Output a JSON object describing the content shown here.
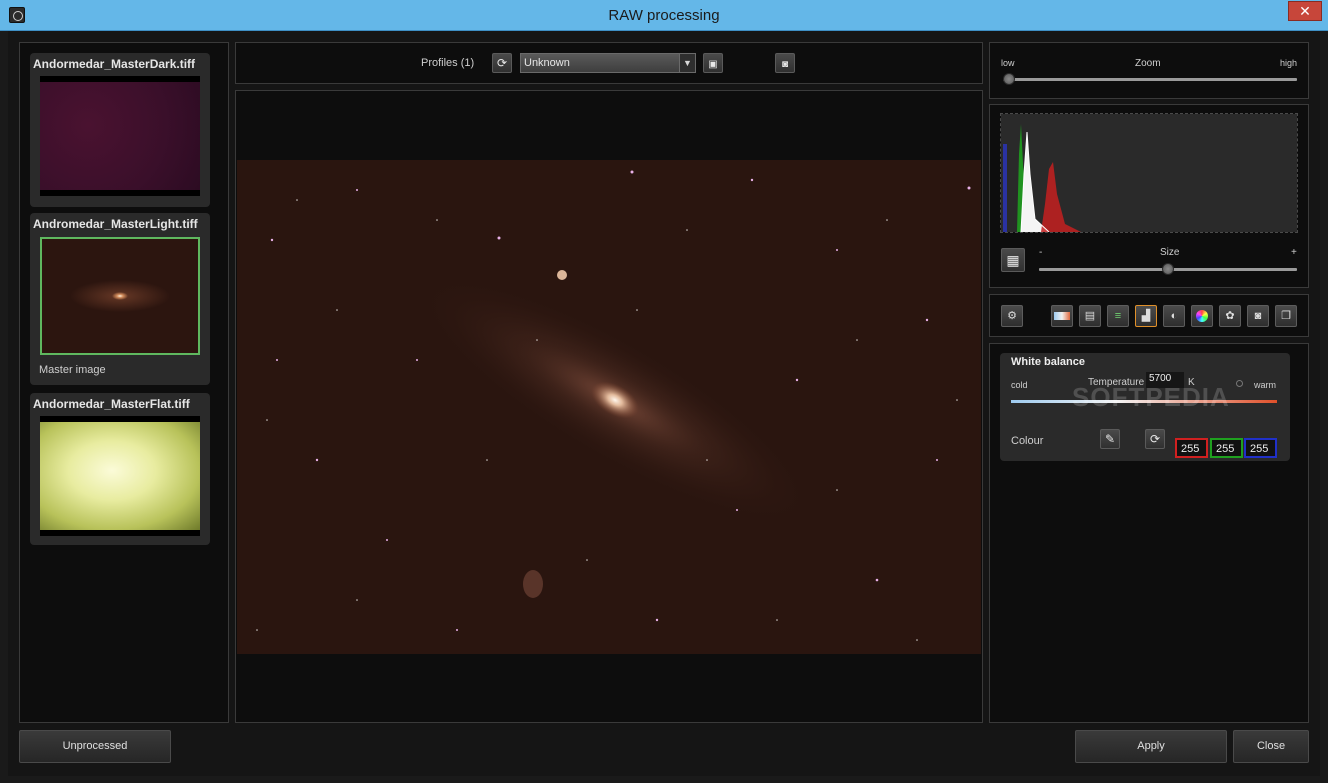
{
  "window": {
    "title": "RAW processing",
    "close_glyph": "✕"
  },
  "frames": [
    {
      "name": "Andormedar_MasterDark.tiff",
      "caption": ""
    },
    {
      "name": "Andromedar_MasterLight.tiff",
      "caption": "Master image"
    },
    {
      "name": "Andormedar_MasterFlat.tiff",
      "caption": ""
    }
  ],
  "toolbar": {
    "profiles_label": "Profiles (1)",
    "profile_value": "Unknown"
  },
  "zoom": {
    "low_label": "low",
    "title": "Zoom",
    "high_label": "high",
    "level": 0.0
  },
  "histogram": {
    "size_minus": "-",
    "size_title": "Size",
    "size_plus": "+",
    "size_level": 0.5
  },
  "white_balance": {
    "title": "White balance",
    "cold_label": "cold",
    "temperature_label": "Temperature",
    "temperature_value": "5700",
    "temperature_unit": "K",
    "warm_label": "warm",
    "colour_label": "Colour",
    "red": "255",
    "green": "255",
    "blue": "255"
  },
  "watermark": "SOFTPEDIA",
  "footer": {
    "unprocessed_label": "Unprocessed",
    "apply_label": "Apply",
    "close_label": "Close"
  },
  "colors": {
    "titlebar": "#64b7e8",
    "accent_green": "#5fb85f",
    "red": "#d02020",
    "green": "#1fa01f",
    "blue": "#2030c8"
  }
}
